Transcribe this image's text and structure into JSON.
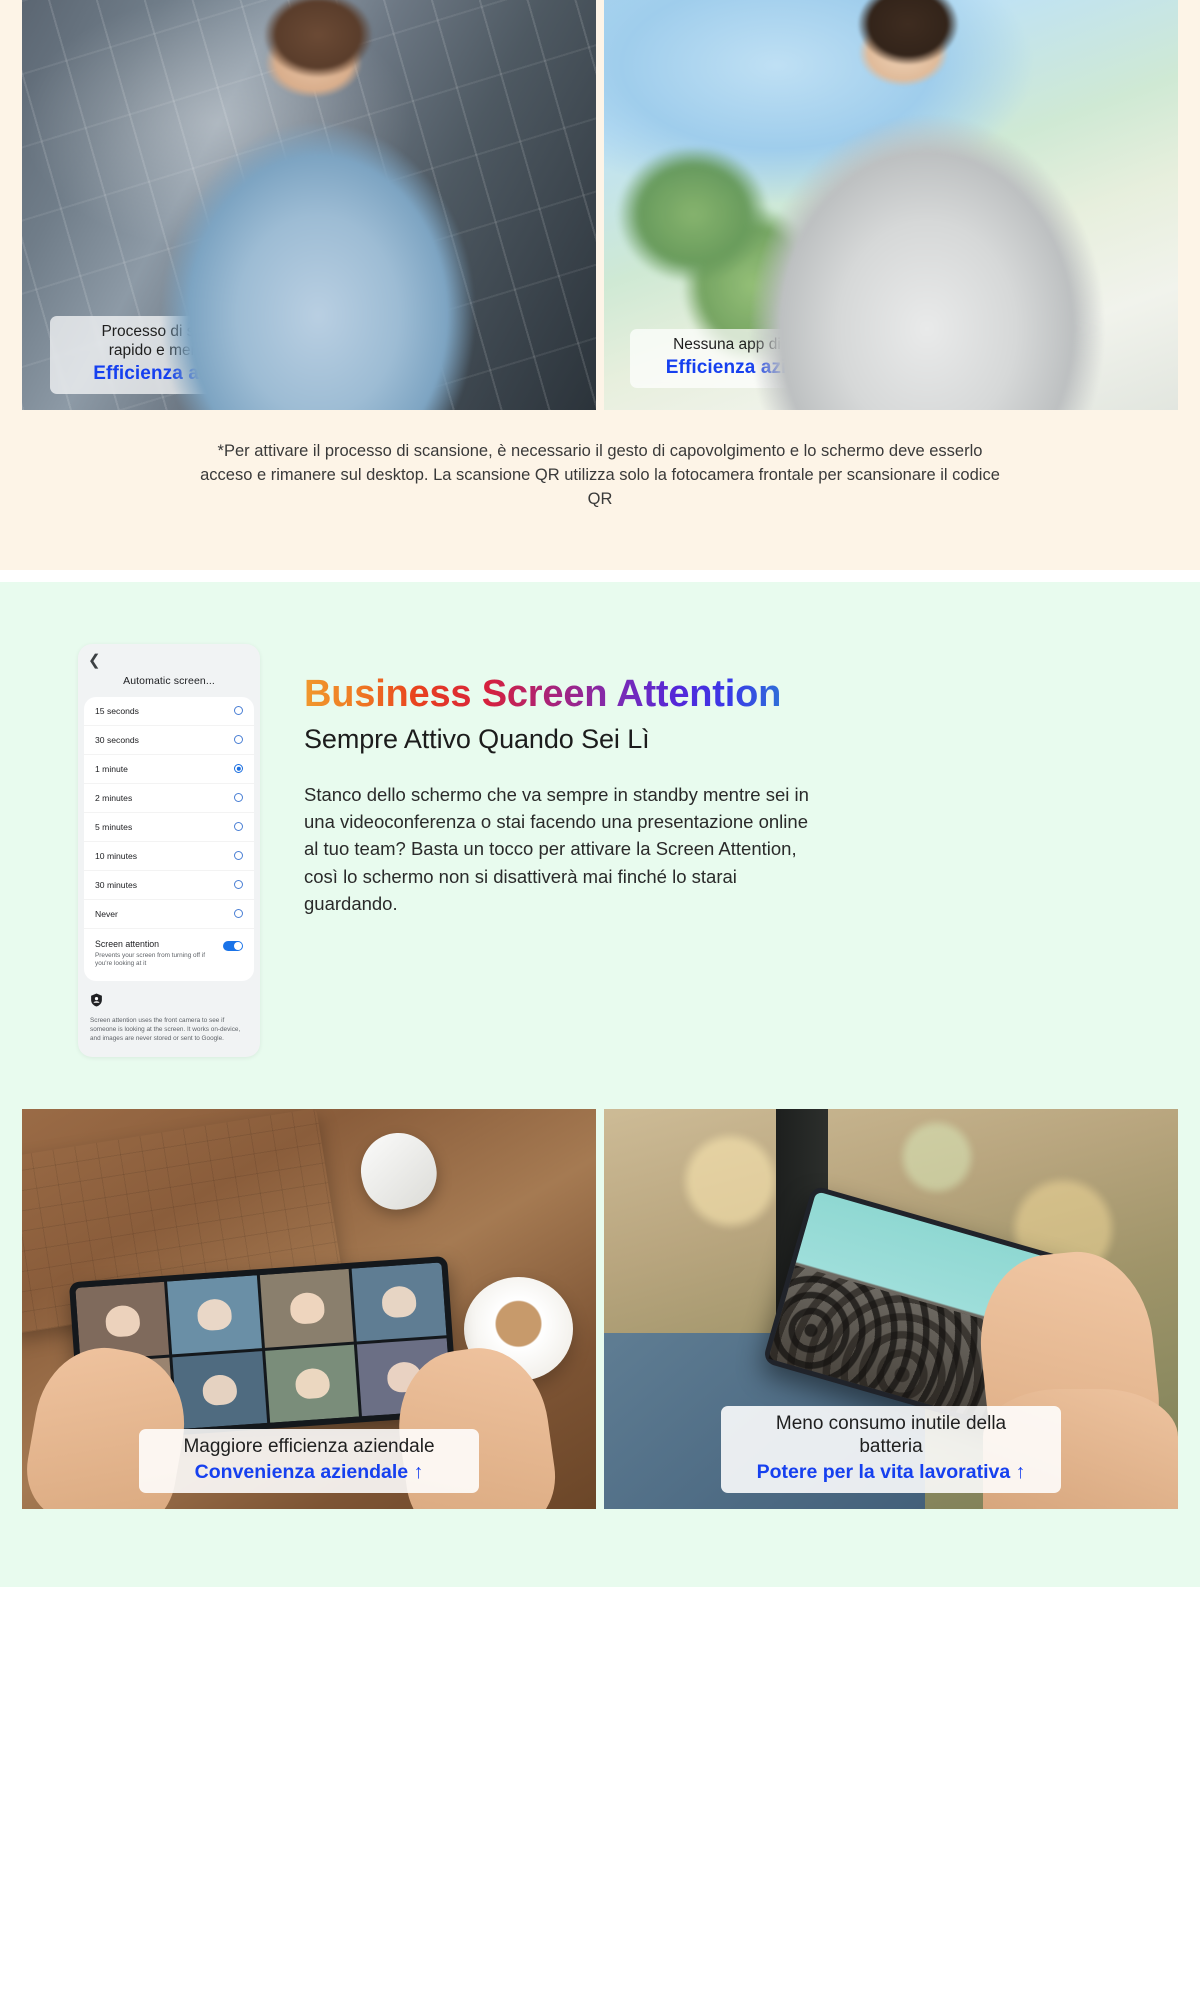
{
  "section_scan": {
    "left_photo": {
      "alt_name": "businessman-scanning-qr-indoor",
      "caption_top": "Processo di scansione più\nrapido e meno passaggi",
      "caption_bottom": "Efficienza aziendale ↑"
    },
    "right_photo": {
      "alt_name": "businessman-scanning-qr-outdoor",
      "caption_top": "Nessuna app di scansione",
      "caption_bottom": "Efficienza aziendale ↑"
    },
    "footnote": "*Per attivare il processo di scansione, è necessario il gesto di capovolgimento e lo schermo deve esserlo acceso e rimanere sul desktop. La scansione QR utilizza solo la fotocamera frontale per scansionare il codice QR"
  },
  "section_attention": {
    "phone_settings": {
      "back_icon": "chevron-left-icon",
      "title": "Automatic screen...",
      "options": [
        {
          "label": "15 seconds",
          "selected": false
        },
        {
          "label": "30 seconds",
          "selected": false
        },
        {
          "label": "1 minute",
          "selected": true
        },
        {
          "label": "2 minutes",
          "selected": false
        },
        {
          "label": "5 minutes",
          "selected": false
        },
        {
          "label": "10 minutes",
          "selected": false
        },
        {
          "label": "30 minutes",
          "selected": false
        },
        {
          "label": "Never",
          "selected": false
        }
      ],
      "attention": {
        "title": "Screen attention",
        "description": "Prevents your screen from turning off if you're looking at it",
        "toggle_on": true
      },
      "note": {
        "icon": "privacy-shield-icon",
        "text": "Screen attention uses the front camera to see if someone is looking at the screen. It works on-device, and images are never stored or sent to Google."
      }
    },
    "headline": "Business Screen Attention",
    "subhead": "Sempre Attivo Quando Sei Lì",
    "body": "Stanco dello schermo che va sempre in standby mentre sei in una videoconferenza o stai facendo una presentazione online al tuo team? Basta un tocco per attivare la Screen Attention, così lo schermo non si disattiverà mai finché lo starai guardando.",
    "left_photo": {
      "alt_name": "video-conference-on-phone-at-desk",
      "caption_top": "Maggiore efficienza aziendale",
      "caption_bottom": "Convenienza aziendale ↑"
    },
    "right_photo": {
      "alt_name": "watching-video-on-phone-outdoors",
      "caption_top": "Meno consumo inutile della batteria",
      "caption_bottom": "Potere per la vita lavorativa ↑"
    }
  },
  "colors": {
    "cream_bg": "#fdf4e7",
    "mint_bg": "#e8fbee",
    "accent_blue": "#1640ef",
    "toggle_blue": "#1a73e8",
    "radio_blue": "#1a6ee0"
  }
}
